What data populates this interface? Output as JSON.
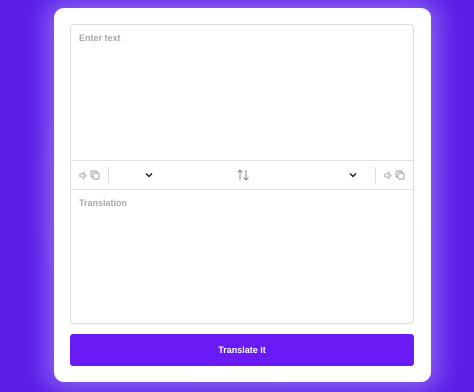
{
  "colors": {
    "background": "#5b1fe8",
    "accent": "#6a1af5",
    "card": "#ffffff"
  },
  "source": {
    "placeholder": "Enter text",
    "language": ""
  },
  "target": {
    "language": "",
    "placeholder": "Translation"
  },
  "toolbar": {
    "left_icons": [
      "speaker-icon",
      "copy-icon"
    ],
    "swap_icon": "swap-arrows-icon",
    "right_icons": [
      "speaker-icon",
      "copy-icon"
    ]
  },
  "action": {
    "translate_label": "Translate it"
  }
}
